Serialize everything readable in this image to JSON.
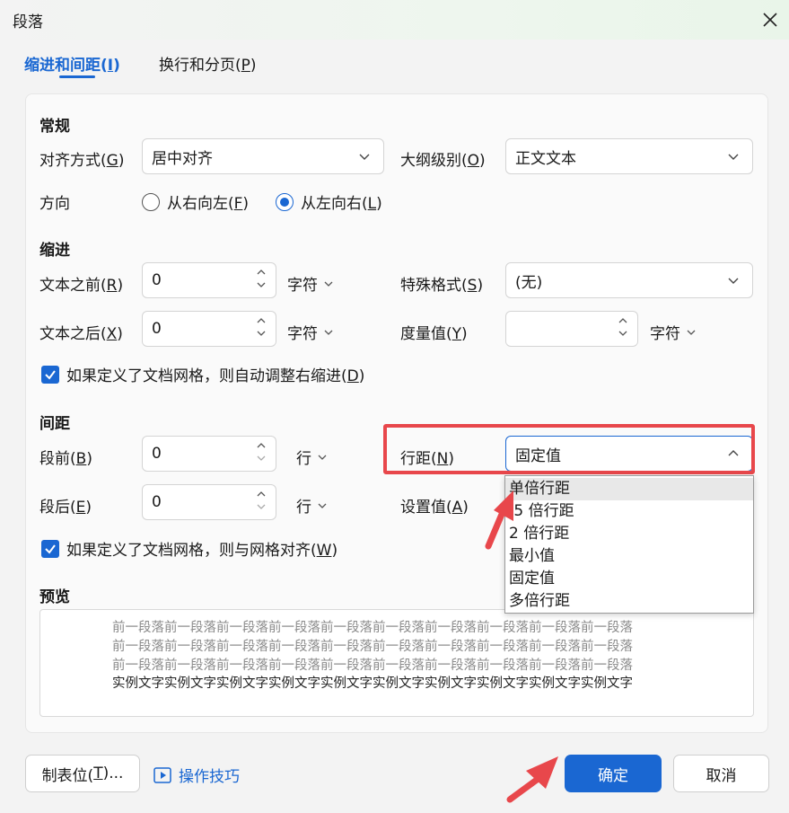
{
  "window": {
    "title": "段落"
  },
  "tabs": [
    {
      "label": "缩进和间距(",
      "key": "I",
      "close": ")"
    },
    {
      "label": "换行和分页(",
      "key": "P",
      "close": ")"
    }
  ],
  "general": {
    "title": "常规",
    "align_label": "对齐方式(",
    "align_key": "G",
    "align_value": "居中对齐",
    "outline_label": "大纲级别(",
    "outline_key": "O",
    "outline_value": "正文文本",
    "direction_label": "方向",
    "rtl_label": "从右向左(",
    "rtl_key": "F",
    "ltr_label": "从左向右(",
    "ltr_key": "L"
  },
  "indent": {
    "title": "缩进",
    "before_label": "文本之前(",
    "before_key": "R",
    "before_value": "0",
    "before_unit": "字符",
    "after_label": "文本之后(",
    "after_key": "X",
    "after_value": "0",
    "after_unit": "字符",
    "special_label": "特殊格式(",
    "special_key": "S",
    "special_value": "(无)",
    "measure_label": "度量值(",
    "measure_key": "Y",
    "measure_value": "",
    "measure_unit": "字符",
    "grid_check_label": "如果定义了文档网格，则自动调整右缩进(",
    "grid_check_key": "D"
  },
  "spacing": {
    "title": "间距",
    "before_label": "段前(",
    "before_key": "B",
    "before_value": "0",
    "before_unit": "行",
    "after_label": "段后(",
    "after_key": "E",
    "after_value": "0",
    "after_unit": "行",
    "line_label": "行距(",
    "line_key": "N",
    "line_value": "固定值",
    "set_label": "设置值(",
    "set_key": "A",
    "grid_check_label": "如果定义了文档网格，则与网格对齐(",
    "grid_check_key": "W"
  },
  "line_spacing_options": [
    "单倍行距",
    "1.5 倍行距",
    "2 倍行距",
    "最小值",
    "固定值",
    "多倍行距"
  ],
  "line_spacing_visible": [
    "单倍行距",
    ".5 倍行距",
    "2 倍行距",
    "最小值",
    "固定值",
    "多倍行距"
  ],
  "preview": {
    "title": "预览",
    "prev_line": "前一段落前一段落前一段落前一段落前一段落前一段落前一段落前一段落前一段落前一段落",
    "sample_line": "实例文字实例文字实例文字实例文字实例文字实例文字实例文字实例文字实例文字实例文字"
  },
  "footer": {
    "tabs_button": "制表位(",
    "tabs_key": "T",
    "tabs_suffix": ")...",
    "tips_link": "操作技巧",
    "ok": "确定",
    "cancel": "取消"
  },
  "colors": {
    "accent": "#1a67d2",
    "highlight": "#e8474b"
  }
}
